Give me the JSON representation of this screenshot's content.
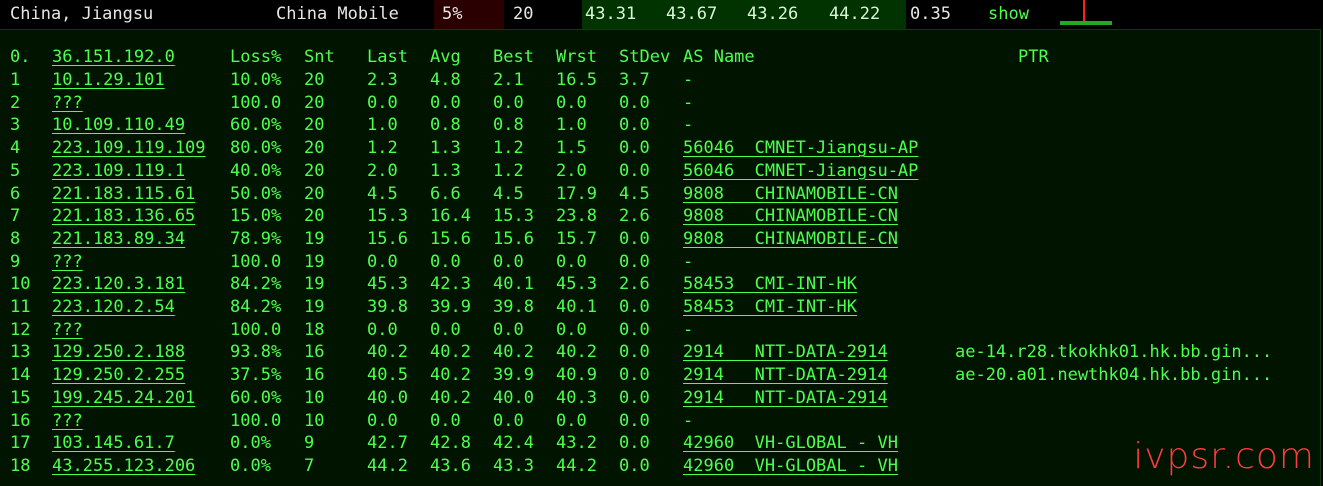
{
  "topbar": {
    "location": "China, Jiangsu",
    "isp": "China Mobile",
    "loss": "5%",
    "sent": "20",
    "last": "43.31",
    "avg": "43.67",
    "best": "43.26",
    "worst": "44.22",
    "stdev": "0.35",
    "show_link": "show",
    "loss_color": "#2a0000",
    "latency_color": "#003300"
  },
  "headers": {
    "hop": "0.",
    "host": "36.151.192.0",
    "loss": "Loss%",
    "snt": "Snt",
    "last": "Last",
    "avg": "Avg",
    "best": "Best",
    "wrst": "Wrst",
    "stdev": "StDev",
    "as_name": "AS Name",
    "ptr": "PTR"
  },
  "hops": [
    {
      "hop": "1",
      "host": "10.1.29.101",
      "loss": "10.0%",
      "snt": "20",
      "last": "2.3",
      "avg": "4.8",
      "best": "2.1",
      "wrst": "16.5",
      "stdev": "3.7",
      "as": "-",
      "ptr": ""
    },
    {
      "hop": "2",
      "host": "???",
      "loss": "100.0",
      "snt": "20",
      "last": "0.0",
      "avg": "0.0",
      "best": "0.0",
      "wrst": "0.0",
      "stdev": "0.0",
      "as": "-",
      "ptr": ""
    },
    {
      "hop": "3",
      "host": "10.109.110.49",
      "loss": "60.0%",
      "snt": "20",
      "last": "1.0",
      "avg": "0.8",
      "best": "0.8",
      "wrst": "1.0",
      "stdev": "0.0",
      "as": "-",
      "ptr": ""
    },
    {
      "hop": "4",
      "host": "223.109.119.109",
      "loss": "80.0%",
      "snt": "20",
      "last": "1.2",
      "avg": "1.3",
      "best": "1.2",
      "wrst": "1.5",
      "stdev": "0.0",
      "as": "56046  CMNET-Jiangsu-AP",
      "ptr": ""
    },
    {
      "hop": "5",
      "host": "223.109.119.1",
      "loss": "40.0%",
      "snt": "20",
      "last": "2.0",
      "avg": "1.3",
      "best": "1.2",
      "wrst": "2.0",
      "stdev": "0.0",
      "as": "56046  CMNET-Jiangsu-AP",
      "ptr": ""
    },
    {
      "hop": "6",
      "host": "221.183.115.61",
      "loss": "50.0%",
      "snt": "20",
      "last": "4.5",
      "avg": "6.6",
      "best": "4.5",
      "wrst": "17.9",
      "stdev": "4.5",
      "as": "9808   CHINAMOBILE-CN",
      "ptr": ""
    },
    {
      "hop": "7",
      "host": "221.183.136.65",
      "loss": "15.0%",
      "snt": "20",
      "last": "15.3",
      "avg": "16.4",
      "best": "15.3",
      "wrst": "23.8",
      "stdev": "2.6",
      "as": "9808   CHINAMOBILE-CN",
      "ptr": ""
    },
    {
      "hop": "8",
      "host": "221.183.89.34",
      "loss": "78.9%",
      "snt": "19",
      "last": "15.6",
      "avg": "15.6",
      "best": "15.6",
      "wrst": "15.7",
      "stdev": "0.0",
      "as": "9808   CHINAMOBILE-CN",
      "ptr": ""
    },
    {
      "hop": "9",
      "host": "???",
      "loss": "100.0",
      "snt": "19",
      "last": "0.0",
      "avg": "0.0",
      "best": "0.0",
      "wrst": "0.0",
      "stdev": "0.0",
      "as": "-",
      "ptr": ""
    },
    {
      "hop": "10",
      "host": "223.120.3.181",
      "loss": "84.2%",
      "snt": "19",
      "last": "45.3",
      "avg": "42.3",
      "best": "40.1",
      "wrst": "45.3",
      "stdev": "2.6",
      "as": "58453  CMI-INT-HK",
      "ptr": ""
    },
    {
      "hop": "11",
      "host": "223.120.2.54",
      "loss": "84.2%",
      "snt": "19",
      "last": "39.8",
      "avg": "39.9",
      "best": "39.8",
      "wrst": "40.1",
      "stdev": "0.0",
      "as": "58453  CMI-INT-HK",
      "ptr": ""
    },
    {
      "hop": "12",
      "host": "???",
      "loss": "100.0",
      "snt": "18",
      "last": "0.0",
      "avg": "0.0",
      "best": "0.0",
      "wrst": "0.0",
      "stdev": "0.0",
      "as": "-",
      "ptr": ""
    },
    {
      "hop": "13",
      "host": "129.250.2.188",
      "loss": "93.8%",
      "snt": "16",
      "last": "40.2",
      "avg": "40.2",
      "best": "40.2",
      "wrst": "40.2",
      "stdev": "0.0",
      "as": "2914   NTT-DATA-2914",
      "ptr": "ae-14.r28.tkokhk01.hk.bb.gin..."
    },
    {
      "hop": "14",
      "host": "129.250.2.255",
      "loss": "37.5%",
      "snt": "16",
      "last": "40.5",
      "avg": "40.2",
      "best": "39.9",
      "wrst": "40.9",
      "stdev": "0.0",
      "as": "2914   NTT-DATA-2914",
      "ptr": "ae-20.a01.newthk04.hk.bb.gin..."
    },
    {
      "hop": "15",
      "host": "199.245.24.201",
      "loss": "60.0%",
      "snt": "10",
      "last": "40.0",
      "avg": "40.2",
      "best": "40.0",
      "wrst": "40.3",
      "stdev": "0.0",
      "as": "2914   NTT-DATA-2914",
      "ptr": ""
    },
    {
      "hop": "16",
      "host": "???",
      "loss": "100.0",
      "snt": "10",
      "last": "0.0",
      "avg": "0.0",
      "best": "0.0",
      "wrst": "0.0",
      "stdev": "0.0",
      "as": "-",
      "ptr": ""
    },
    {
      "hop": "17",
      "host": "103.145.61.7",
      "loss": "0.0%",
      "snt": "9",
      "last": "42.7",
      "avg": "42.8",
      "best": "42.4",
      "wrst": "43.2",
      "stdev": "0.0",
      "as": "42960  VH-GLOBAL - VH",
      "ptr": ""
    },
    {
      "hop": "18",
      "host": "43.255.123.206",
      "loss": "0.0%",
      "snt": "7",
      "last": "44.2",
      "avg": "43.6",
      "best": "43.3",
      "wrst": "44.2",
      "stdev": "0.0",
      "as": "42960  VH-GLOBAL - VH",
      "ptr": ""
    }
  ],
  "watermark": "ivpsr.com",
  "colors": {
    "terminal_green": "#4dff4d",
    "panel_bg": "#001400",
    "watermark_red": "#ff3b3b"
  }
}
